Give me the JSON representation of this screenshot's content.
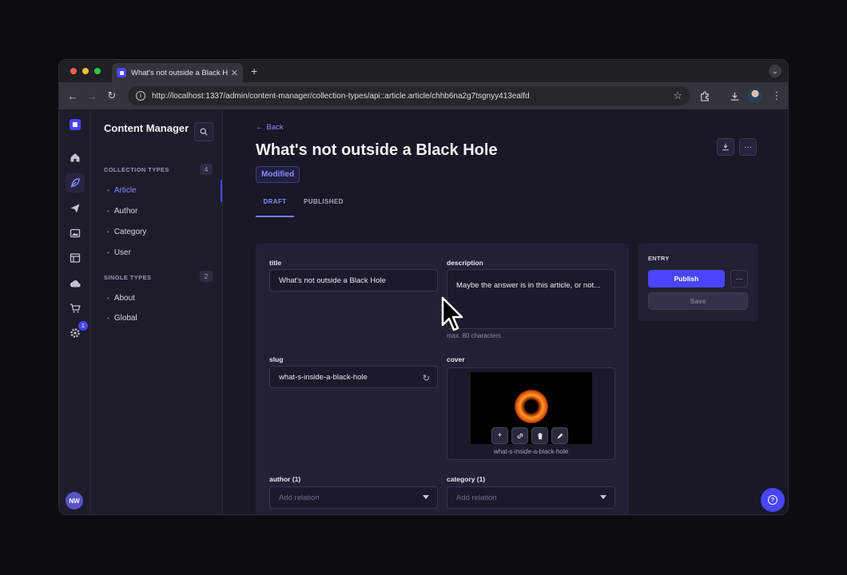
{
  "browser": {
    "tab_title": "What's not outside a Black Hole",
    "url": "http://localhost:1337/admin/content-manager/collection-types/api::article.article/chhb6na2g7tsgnyy413ealfd"
  },
  "rail": {
    "badge_count": "1",
    "avatar_initials": "NW"
  },
  "subnav": {
    "title": "Content Manager",
    "collection_types_label": "COLLECTION TYPES",
    "collection_types_count": "4",
    "collection_items": [
      "Article",
      "Author",
      "Category",
      "User"
    ],
    "single_types_label": "SINGLE TYPES",
    "single_types_count": "2",
    "single_items": [
      "About",
      "Global"
    ]
  },
  "header": {
    "back_label": "Back",
    "title": "What's not outside a Black Hole",
    "status": "Modified"
  },
  "tabs": {
    "draft": "DRAFT",
    "published": "PUBLISHED"
  },
  "form": {
    "title_label": "title",
    "title_value": "What's not outside a Black Hole",
    "description_label": "description",
    "description_value": "Maybe the answer is in this article, or not...",
    "description_hint": "max. 80 characters",
    "slug_label": "slug",
    "slug_value": "what-s-inside-a-black-hole",
    "cover_label": "cover",
    "cover_caption": "what-s-inside-a-black-hole",
    "author_label": "author (1)",
    "author_placeholder": "Add relation",
    "category_label": "category (1)",
    "category_placeholder": "Add relation"
  },
  "entry": {
    "heading": "ENTRY",
    "publish_label": "Publish",
    "save_label": "Save"
  },
  "colors": {
    "accent": "#4945ff",
    "accent_text": "#8c89ff",
    "background": "#181826",
    "card": "#212134"
  }
}
